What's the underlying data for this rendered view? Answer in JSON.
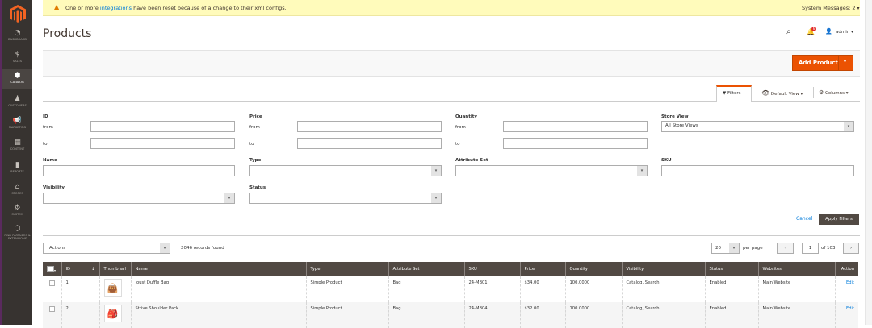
{
  "notice": {
    "prefix": "One or more ",
    "link": "integrations",
    "suffix": " have been reset because of a change to their xml configs.",
    "system_messages": "System Messages: 2"
  },
  "sidebar": {
    "items": [
      {
        "label": "Dashboard",
        "icon": "dashboard-icon",
        "glyph": "◔"
      },
      {
        "label": "Sales",
        "icon": "dollar-icon",
        "glyph": "$"
      },
      {
        "label": "Catalog",
        "icon": "box-icon",
        "glyph": "⬢",
        "active": true
      },
      {
        "label": "Customers",
        "icon": "person-icon",
        "glyph": "♟"
      },
      {
        "label": "Marketing",
        "icon": "megaphone-icon",
        "glyph": "📢"
      },
      {
        "label": "Content",
        "icon": "layout-icon",
        "glyph": "▦"
      },
      {
        "label": "Reports",
        "icon": "bar-chart-icon",
        "glyph": "▮"
      },
      {
        "label": "Stores",
        "icon": "store-icon",
        "glyph": "⌂"
      },
      {
        "label": "System",
        "icon": "gear-icon",
        "glyph": "⚙"
      },
      {
        "label": "Find Partners & Extensions",
        "icon": "cube-icon",
        "glyph": "⬡"
      }
    ]
  },
  "header": {
    "title": "Products",
    "notifications_count": "6",
    "user": "admin"
  },
  "actions": {
    "add_product": "Add Product"
  },
  "toolbar": {
    "filters": "Filters",
    "default_view": "Default View",
    "columns": "Columns"
  },
  "filters": {
    "id": "ID",
    "price": "Price",
    "quantity": "Quantity",
    "store_view": "Store View",
    "store_view_value": "All Store Views",
    "from": "from",
    "to": "to",
    "name": "Name",
    "type": "Type",
    "attribute_set": "Attribute Set",
    "sku": "SKU",
    "visibility": "Visibility",
    "status": "Status",
    "cancel": "Cancel",
    "apply": "Apply Filters"
  },
  "grid": {
    "actions": "Actions",
    "records": "2046 records found",
    "per_page_value": "20",
    "per_page": "per page",
    "page": "1",
    "of_pages": "of 103",
    "columns": [
      "ID",
      "Thumbnail",
      "Name",
      "Type",
      "Attribute Set",
      "SKU",
      "Price",
      "Quantity",
      "Visibility",
      "Status",
      "Websites",
      "Action"
    ],
    "rows": [
      {
        "id": "1",
        "name": "Joust Duffle Bag",
        "type": "Simple Product",
        "attribute_set": "Bag",
        "sku": "24-MB01",
        "price": "$34.00",
        "quantity": "100.0000",
        "visibility": "Catalog, Search",
        "status": "Enabled",
        "websites": "Main Website",
        "action": "Edit"
      },
      {
        "id": "2",
        "name": "Strive Shoulder Pack",
        "type": "Simple Product",
        "attribute_set": "Bag",
        "sku": "24-MB04",
        "price": "$32.00",
        "quantity": "100.0000",
        "visibility": "Catalog, Search",
        "status": "Enabled",
        "websites": "Main Website",
        "action": "Edit"
      }
    ]
  },
  "colors": {
    "accent": "#eb5202",
    "sidebar": "#373330",
    "table_header": "#514943",
    "notice": "#fffbbb"
  }
}
